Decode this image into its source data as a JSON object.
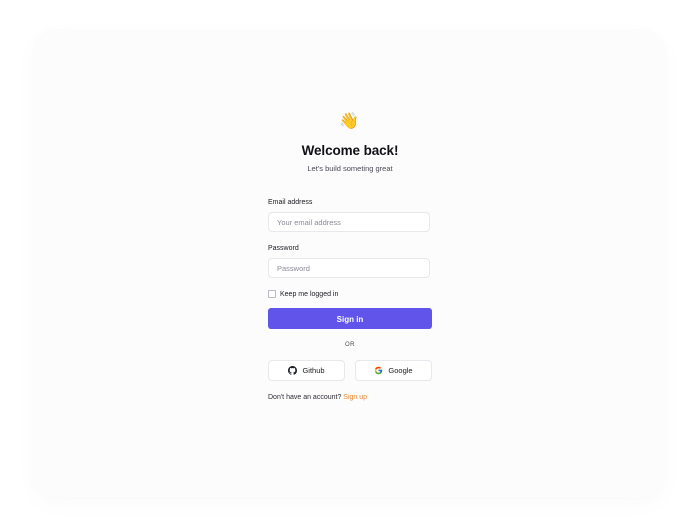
{
  "header": {
    "emoji": "👋",
    "title": "Welcome back!",
    "subtitle": "Let's build someting great"
  },
  "form": {
    "email_label": "Email address",
    "email_placeholder": "Your email address",
    "email_value": "",
    "password_label": "Password",
    "password_placeholder": "Password",
    "password_value": "",
    "remember_label": "Keep me logged in",
    "remember_checked": false,
    "submit_label": "Sign in"
  },
  "divider": {
    "text": "OR"
  },
  "social": {
    "github_label": "Github",
    "github_icon": "github-icon",
    "google_label": "Google",
    "google_icon": "google-icon"
  },
  "footer": {
    "prompt": "Don't have an account?",
    "signup_link": "Sign up"
  },
  "colors": {
    "primary": "#6054ea",
    "link": "#e8852c",
    "panel_bg": "#fcfcfd"
  }
}
